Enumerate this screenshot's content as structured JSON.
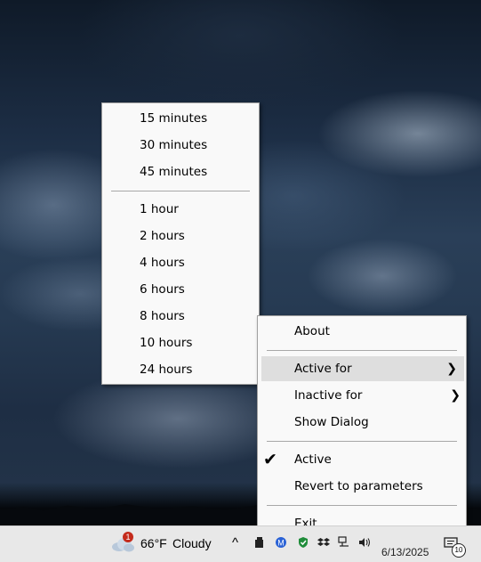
{
  "submenu": {
    "items_a": [
      "15 minutes",
      "30 minutes",
      "45 minutes"
    ],
    "items_b": [
      "1 hour",
      "2 hours",
      "4 hours",
      "6 hours",
      "8 hours",
      "10 hours",
      "24 hours"
    ]
  },
  "menu": {
    "about": "About",
    "active_for": "Active for",
    "inactive_for": "Inactive for",
    "show_dialog": "Show Dialog",
    "active": "Active",
    "revert": "Revert to parameters",
    "exit_first": "E",
    "exit_rest": "xit",
    "arrow": "❯",
    "check": "✔"
  },
  "taskbar": {
    "weather_temp": "66°F",
    "weather_cond": "Cloudy",
    "weather_badge": "1",
    "chevron": "^",
    "date": "6/13/2025",
    "notif_count": "10"
  },
  "colors": {
    "menu_bg": "#f9f9f9",
    "highlight": "#dedede",
    "taskbar_bg": "#e8e8e8",
    "badge": "#c42b1c"
  }
}
